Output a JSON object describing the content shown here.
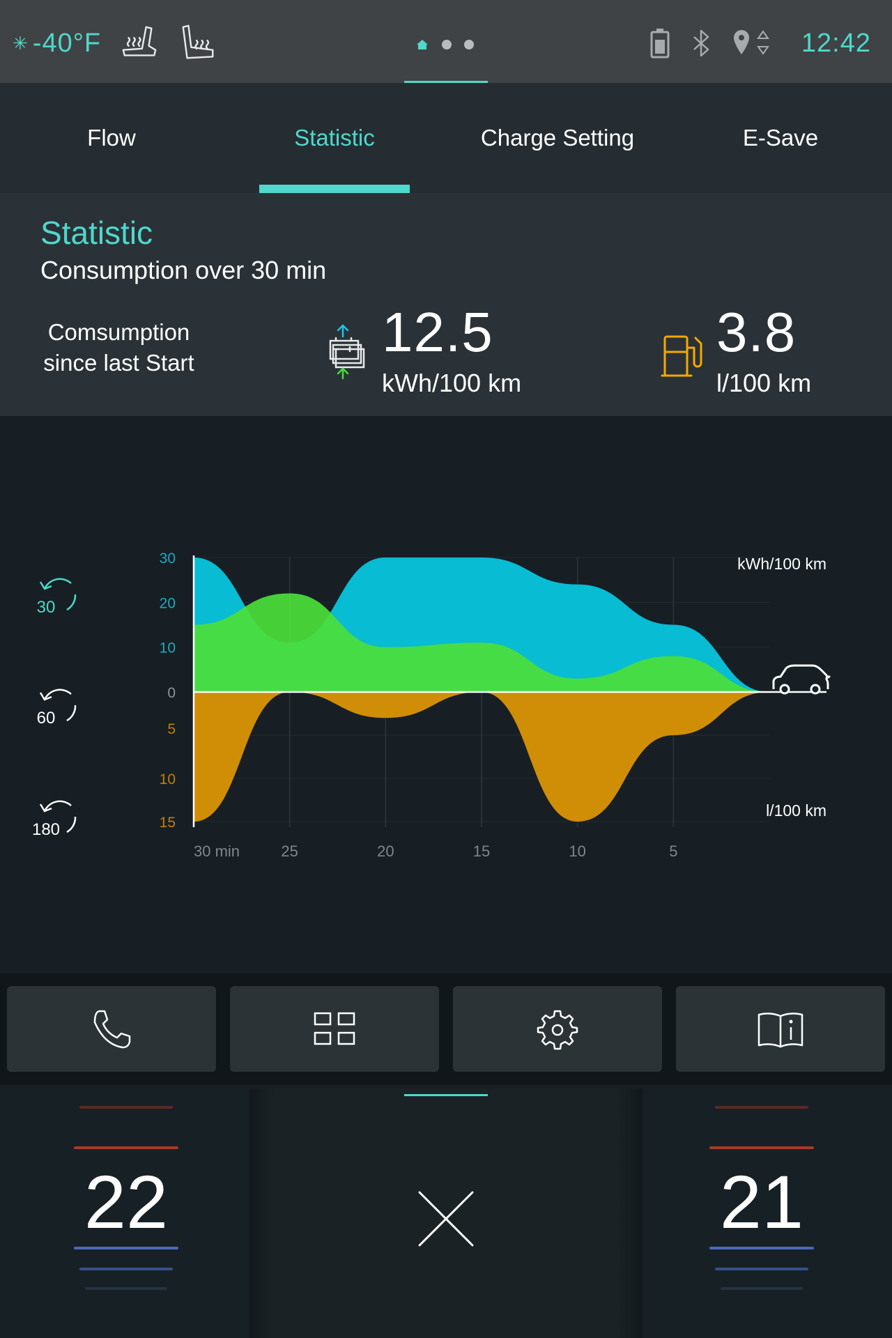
{
  "status": {
    "temperature": "-40°F",
    "time": "12:42"
  },
  "tabs": [
    {
      "label": "Flow"
    },
    {
      "label": "Statistic"
    },
    {
      "label": "Charge Setting"
    },
    {
      "label": "E-Save"
    }
  ],
  "header": {
    "title": "Statistic",
    "subtitle": "Consumption over 30 min",
    "since_label_line1": "Comsumption",
    "since_label_line2": "since last Start",
    "electric": {
      "value": "12.5",
      "unit": "kWh/100 km"
    },
    "fuel": {
      "value": "3.8",
      "unit": "l/100 km"
    }
  },
  "time_ranges": [
    "30",
    "60",
    "180"
  ],
  "chart_data": {
    "type": "area",
    "x_label_first": "30 min",
    "x_ticks": [
      "30 min",
      "25",
      "20",
      "15",
      "10",
      "5"
    ],
    "y_upper_ticks": [
      "30",
      "20",
      "10",
      "0"
    ],
    "y_lower_ticks": [
      "5",
      "10",
      "15"
    ],
    "upper_unit": "kWh/100 km",
    "lower_unit": "l/100 km",
    "x": [
      30,
      25,
      20,
      15,
      10,
      5,
      0
    ],
    "series": [
      {
        "color": "#08bcd3",
        "values": [
          30,
          11,
          30,
          30,
          24,
          15,
          0
        ]
      },
      {
        "color": "#4cde3a",
        "values": [
          15,
          22,
          10,
          11,
          3,
          8,
          0
        ]
      },
      {
        "color": "#d08e06",
        "values": [
          -15,
          0,
          -3,
          0,
          -15,
          -5,
          0
        ]
      }
    ]
  },
  "shortcuts": [
    {
      "icon": "phone-icon"
    },
    {
      "icon": "apps-grid-icon"
    },
    {
      "icon": "settings-gear-icon"
    },
    {
      "icon": "manual-book-icon"
    }
  ],
  "climate": {
    "left_temp": "22",
    "right_temp": "21"
  }
}
